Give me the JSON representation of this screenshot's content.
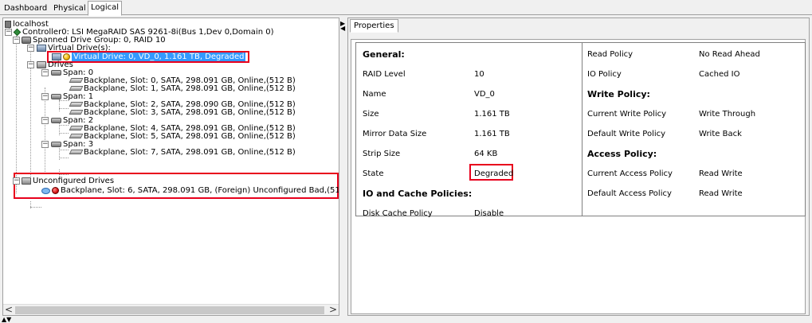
{
  "tabs": [
    "Dashboard",
    "Physical",
    "Logical"
  ],
  "tree": {
    "host": "localhost",
    "controller": "Controller0: LSI MegaRAID SAS 9261-8i(Bus 1,Dev 0,Domain 0)",
    "drive_group": "Spanned Drive Group: 0, RAID  10",
    "virtual_drives": "Virtual Drive(s):",
    "virtual_drive": "Virtual Drive: 0, VD_0, 1.161 TB, Degraded",
    "drives": "Drives",
    "spans": [
      {
        "label": "Span: 0",
        "disks": [
          "Backplane, Slot: 0, SATA, 298.091 GB, Online,(512 B)",
          "Backplane, Slot: 1, SATA, 298.091 GB, Online,(512 B)"
        ]
      },
      {
        "label": "Span: 1",
        "disks": [
          "Backplane, Slot: 2, SATA, 298.090 GB, Online,(512 B)",
          "Backplane, Slot: 3, SATA, 298.091 GB, Online,(512 B)"
        ]
      },
      {
        "label": "Span: 2",
        "disks": [
          "Backplane, Slot: 4, SATA, 298.091 GB, Online,(512 B)",
          "Backplane, Slot: 5, SATA, 298.091 GB, Online,(512 B)"
        ]
      },
      {
        "label": "Span: 3",
        "disks": [
          "Backplane, Slot: 7, SATA, 298.091 GB, Online,(512 B)"
        ]
      }
    ],
    "unconfigured": "Unconfigured Drives",
    "bad_drive": "Backplane, Slot: 6, SATA, 298.091 GB, (Foreign) Unconfigured Bad,(512 B)"
  },
  "properties_tab": "Properties",
  "left_col": {
    "general": "General:",
    "raid_level": {
      "label": "RAID Level",
      "value": "10"
    },
    "name": {
      "label": "Name",
      "value": "VD_0"
    },
    "size": {
      "label": "Size",
      "value": "1.161 TB"
    },
    "mirror": {
      "label": "Mirror Data Size",
      "value": "1.161 TB"
    },
    "strip": {
      "label": "Strip Size",
      "value": "64 KB"
    },
    "state": {
      "label": "State",
      "value": "Degraded"
    },
    "io_cache": "IO and Cache Policies:",
    "disk_cache": {
      "label": "Disk Cache Policy",
      "value": "Disable"
    }
  },
  "right_col": {
    "read_policy": {
      "label": "Read Policy",
      "value": "No Read Ahead"
    },
    "io_policy": {
      "label": "IO Policy",
      "value": "Cached IO"
    },
    "write_policy": "Write Policy:",
    "current_write": {
      "label": "Current Write Policy",
      "value": "Write Through"
    },
    "default_write": {
      "label": "Default Write Policy",
      "value": "Write Back"
    },
    "access_policy": "Access Policy:",
    "current_access": {
      "label": "Current Access Policy",
      "value": "Read Write"
    },
    "default_access": {
      "label": "Default Access Policy",
      "value": "Read Write"
    }
  },
  "scroll": {
    "left_arrow": "<",
    "right_arrow": ">"
  },
  "colors": {
    "selection": "#3399ff",
    "highlight_box": "#e8001c",
    "degraded": "#f0b400",
    "bad": "#d41010"
  },
  "icons": [
    "server-icon",
    "controller-icon",
    "drive-group-icon",
    "virtual-drive-icon",
    "warning-status-icon",
    "drives-icon",
    "span-icon",
    "disk-icon",
    "foreign-icon",
    "error-status-icon"
  ]
}
